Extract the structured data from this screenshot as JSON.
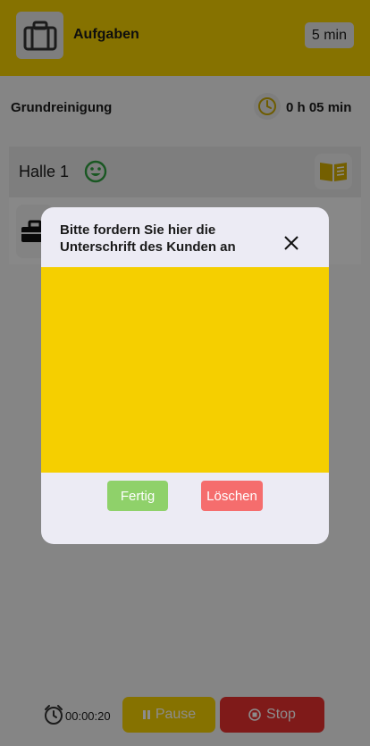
{
  "header": {
    "title": "Aufgaben",
    "duration_badge": "5 min",
    "icon": "briefcase-icon"
  },
  "section": {
    "title": "Grundreinigung",
    "time": "0 h 05 min",
    "icon": "clock-icon"
  },
  "task": {
    "label": "Halle 1",
    "status_icon": "smiley-icon",
    "action_icon": "book-icon"
  },
  "task2": {
    "icon": "toolbox-icon"
  },
  "dialog": {
    "title": "Bitte fordern Sie hier die Unterschrift des Kunden an",
    "done_label": "Fertig",
    "clear_label": "Löschen"
  },
  "bottom": {
    "timer": "00:00:20",
    "pause_label": "Pause",
    "stop_label": "Stop"
  },
  "colors": {
    "accent": "#f5cf00",
    "done": "#8fd16a",
    "clear": "#f56d6d",
    "stop": "#e8302e",
    "smiley": "#2e9e3e"
  }
}
